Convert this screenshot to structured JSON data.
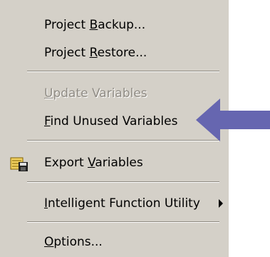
{
  "menu": {
    "items": [
      {
        "label": "Project Backup...",
        "mnemonic_index": 8,
        "disabled": false
      },
      {
        "label": "Project Restore...",
        "mnemonic_index": 8,
        "disabled": false
      },
      {
        "label": "Update Variables",
        "mnemonic_index": 0,
        "disabled": true
      },
      {
        "label": "Find Unused Variables",
        "mnemonic_index": 0,
        "disabled": false
      },
      {
        "label": "Export Variables",
        "mnemonic_index": 7,
        "disabled": false,
        "icon": "export-variables-icon"
      },
      {
        "label": "Intelligent Function Utility",
        "mnemonic_index": 0,
        "disabled": false,
        "has_submenu": true
      },
      {
        "label": "Options...",
        "mnemonic_index": 0,
        "disabled": false
      }
    ]
  },
  "annotation": {
    "icon": "left-pointing-arrow",
    "color": "#6666b0"
  },
  "colors": {
    "menu_bg": "#d4d0c8",
    "disabled_text": "#8f8b84"
  }
}
